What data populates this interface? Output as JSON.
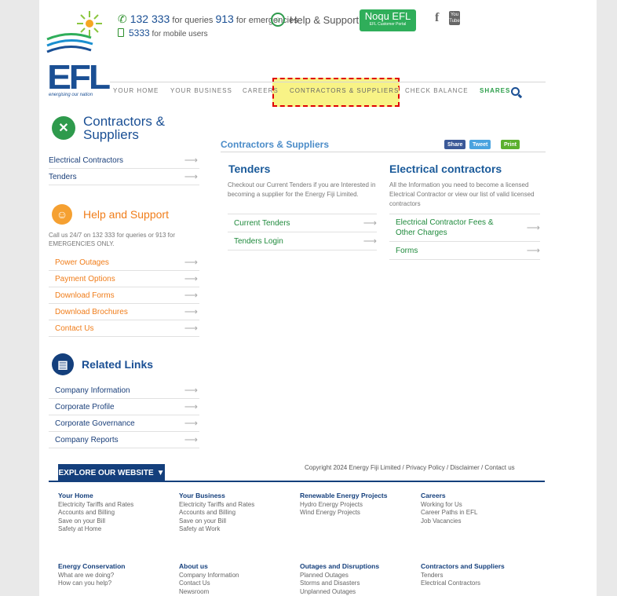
{
  "header": {
    "phone_number": "132 333",
    "phone_mid": "for queries",
    "emergency_number": "913",
    "phone_tail": "for emergencies",
    "mobile_number": "5333",
    "mobile_text": "for mobile users",
    "help_label": "Help & Support",
    "noqu_title": "Noqu EFL",
    "noqu_sub": "EFL Customer Portal",
    "facebook": "f",
    "youtube": "You Tube",
    "logo_text": "EFL",
    "logo_tagline": "energising our nation"
  },
  "nav": {
    "items": [
      "YOUR HOME",
      "YOUR BUSINESS",
      "CAREERS",
      "CONTRACTORS & SUPPLIERS",
      "CHECK BALANCE",
      "SHARES"
    ]
  },
  "sidebar": {
    "contractors_title_1": "Contractors &",
    "contractors_title_2": "Suppliers",
    "contractors_items": [
      "Electrical Contractors",
      "Tenders"
    ],
    "help_title": "Help and Support",
    "help_desc": "Call us 24/7 on 132 333 for queries or 913 for EMERGENCIES ONLY.",
    "help_items": [
      "Power Outages",
      "Payment Options",
      "Download Forms",
      "Download Brochures",
      "Contact Us"
    ],
    "related_title": "Related Links",
    "related_items": [
      "Company Information",
      "Corporate Profile",
      "Corporate Governance",
      "Company Reports"
    ]
  },
  "main": {
    "title": "Contractors & Suppliers",
    "share": "Share",
    "tweet": "Tweet",
    "print": "Print",
    "tenders_title": "Tenders",
    "tenders_desc": "Checkout our Current Tenders if you are Interested in becoming a supplier for the Energy Fiji Limited.",
    "tenders_links": [
      "Current Tenders",
      "Tenders Login"
    ],
    "electrical_title": "Electrical contractors",
    "electrical_desc": "All the Information you need to become a licensed Electrical Contractor or view our list of valid licensed contractors",
    "electrical_links": [
      "Electrical Contractor Fees & Other Charges",
      "Forms"
    ]
  },
  "footer": {
    "explore": "EXPLORE OUR WEBSITE",
    "copyright": "Copyright 2024 Energy Fiji Limited / Privacy Policy / Disclaimer / Contact us",
    "columns": [
      {
        "title": "Your Home",
        "items": [
          "Electricity Tariffs and Rates",
          "Accounts and Billing",
          "Save on your Bill",
          "Safety at Home"
        ]
      },
      {
        "title": "Your Business",
        "items": [
          "Electricity Tariffs and Rates",
          "Accounts and Billing",
          "Save on your Bill",
          "Safety at Work"
        ]
      },
      {
        "title": "Renewable Energy Projects",
        "items": [
          "Hydro Energy Projects",
          "Wind Energy Projects"
        ]
      },
      {
        "title": "Careers",
        "items": [
          "Working for Us",
          "Career Paths in EFL",
          "Job Vacancies"
        ]
      },
      {
        "title": "Energy Conservation",
        "items": [
          "What are we doing?",
          "How can you help?"
        ]
      },
      {
        "title": "About us",
        "items": [
          "Company Information",
          "Contact Us",
          "Newsroom"
        ]
      },
      {
        "title": "Outages and Disruptions",
        "items": [
          "Planned Outages",
          "Storms and Disasters",
          "Unplanned Outages"
        ]
      },
      {
        "title": "Contractors and Suppliers",
        "items": [
          "Tenders",
          "Electrical Contractors"
        ]
      }
    ]
  },
  "colors": {
    "brand_blue": "#1a4f94",
    "green": "#2e9a4c",
    "orange": "#f07d1a",
    "highlight": "#f8f386"
  }
}
